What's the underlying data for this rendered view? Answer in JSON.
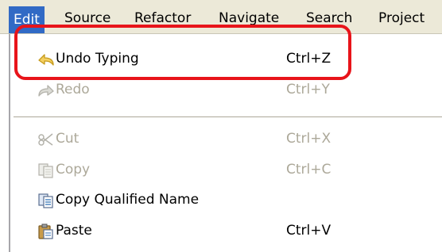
{
  "menubar": {
    "items": [
      {
        "label": "Edit",
        "active": true
      },
      {
        "label": "Source"
      },
      {
        "label": "Refactor"
      },
      {
        "label": "Navigate"
      },
      {
        "label": "Search"
      },
      {
        "label": "Project"
      }
    ]
  },
  "edit_menu": {
    "items": [
      {
        "label": "Undo Typing",
        "shortcut": "Ctrl+Z",
        "enabled": true,
        "icon": "undo-arrow-icon"
      },
      {
        "label": "Redo",
        "shortcut": "Ctrl+Y",
        "enabled": false,
        "icon": "redo-arrow-icon"
      },
      {
        "label": "Cut",
        "shortcut": "Ctrl+X",
        "enabled": false,
        "icon": "scissors-icon"
      },
      {
        "label": "Copy",
        "shortcut": "Ctrl+C",
        "enabled": false,
        "icon": "copy-icon"
      },
      {
        "label": "Copy Qualified Name",
        "shortcut": "",
        "enabled": true,
        "icon": "copy-qualified-name-icon"
      },
      {
        "label": "Paste",
        "shortcut": "Ctrl+V",
        "enabled": true,
        "icon": "paste-icon"
      }
    ]
  },
  "annotation": {
    "color": "#e8141a",
    "target": "Undo Typing"
  },
  "colors": {
    "menubar_bg": "#ece9d8",
    "selected_bg": "#316ac5",
    "disabled_text": "#aca899"
  }
}
